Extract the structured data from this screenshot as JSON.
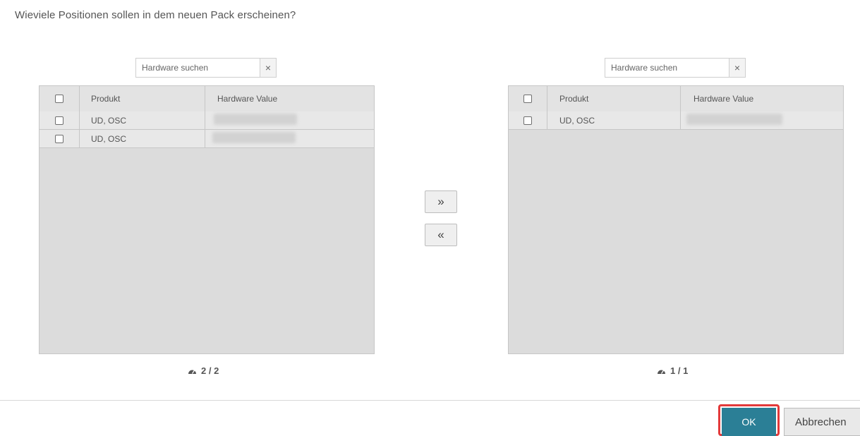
{
  "dialog": {
    "question": "Wieviele Positionen sollen in dem neuen Pack erscheinen?"
  },
  "left_panel": {
    "search": {
      "placeholder": "Hardware suchen",
      "clear_glyph": "×"
    },
    "columns": {
      "product": "Produkt",
      "hardware_value": "Hardware Value"
    },
    "rows": [
      {
        "product": "UD, OSC",
        "hardware_value_redacted": true
      },
      {
        "product": "UD, OSC",
        "hardware_value_redacted": true
      }
    ],
    "counter": "2 / 2"
  },
  "right_panel": {
    "search": {
      "placeholder": "Hardware suchen",
      "clear_glyph": "×"
    },
    "columns": {
      "product": "Produkt",
      "hardware_value": "Hardware Value"
    },
    "rows": [
      {
        "product": "UD, OSC",
        "hardware_value_redacted": true
      }
    ],
    "counter": "1 / 1"
  },
  "transfer": {
    "move_right": "»",
    "move_left": "«"
  },
  "footer": {
    "ok_label": "OK",
    "cancel_label": "Abbrechen"
  },
  "colors": {
    "ok_button": "#2b7f96",
    "highlight": "#e3393a",
    "grid_background": "#dcdcdc"
  }
}
